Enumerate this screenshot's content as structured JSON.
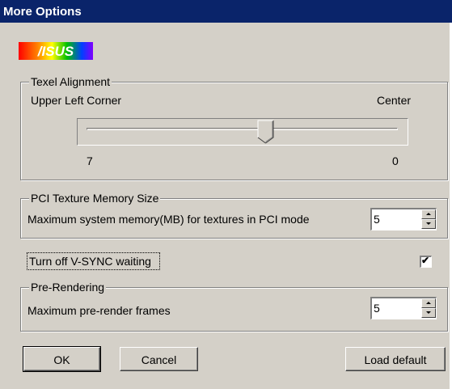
{
  "window": {
    "title": "More Options"
  },
  "logo": {
    "text": "/ISUS"
  },
  "texel": {
    "legend": "Texel Alignment",
    "left_label": "Upper Left Corner",
    "right_label": "Center",
    "left_value": "7",
    "right_value": "0",
    "slider_position": 0.58
  },
  "pci": {
    "legend": "PCI Texture Memory Size",
    "label": "Maximum system memory(MB) for textures in PCI mode",
    "value": "5"
  },
  "vsync": {
    "label": "Turn off V-SYNC waiting",
    "checked": true
  },
  "prerender": {
    "legend": "Pre-Rendering",
    "label": "Maximum pre-render frames",
    "value": "5"
  },
  "buttons": {
    "ok": "OK",
    "cancel": "Cancel",
    "load_default": "Load default"
  },
  "colors": {
    "title_bg": "#0a246a",
    "dialog_bg": "#d4d0c8"
  }
}
